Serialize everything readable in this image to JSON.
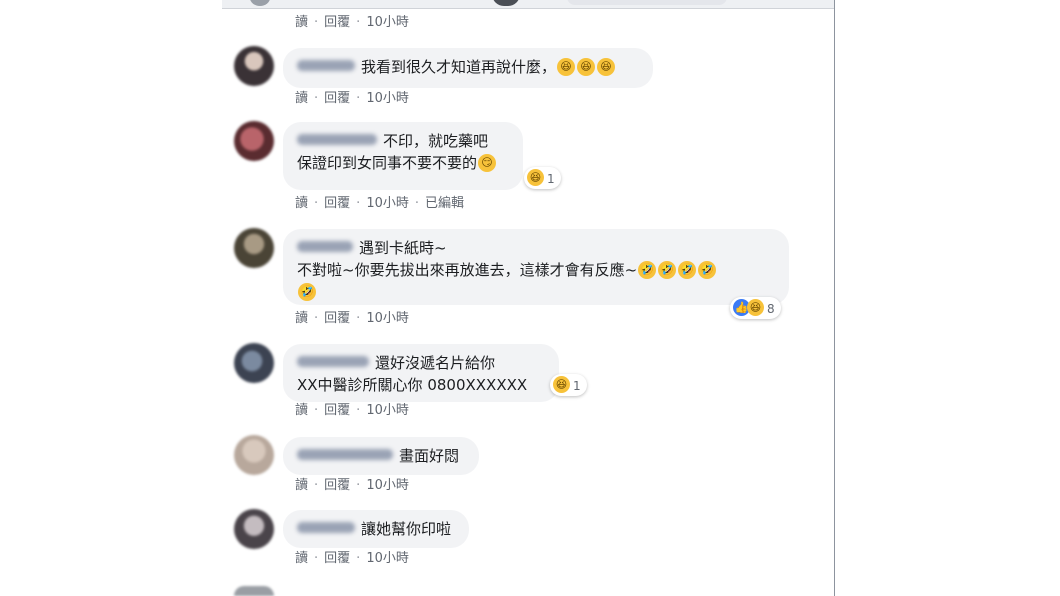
{
  "comments": [
    {
      "lines": [],
      "actions": {
        "read": "讀",
        "reply": "回覆",
        "time": "10小時",
        "edited": ""
      }
    },
    {
      "lines": [
        "我看到很久才知道再說什麼，"
      ],
      "emoji": [
        "laughing-emoji",
        "laughing-emoji",
        "laughing-emoji"
      ],
      "actions": {
        "read": "讀",
        "reply": "回覆",
        "time": "10小時",
        "edited": ""
      }
    },
    {
      "lines": [
        "不印，就吃藥吧",
        "保證印到女同事不要不要的"
      ],
      "reaction": {
        "icons": [
          "haha-icon"
        ],
        "count": "1"
      },
      "actions": {
        "read": "讀",
        "reply": "回覆",
        "time": "10小時",
        "edited": "已編輯"
      }
    },
    {
      "lines": [
        "遇到卡紙時~",
        "不對啦~你要先拔出來再放進去，這樣才會有反應~"
      ],
      "reaction": {
        "icons": [
          "like-icon",
          "haha-icon"
        ],
        "count": "8"
      },
      "actions": {
        "read": "讀",
        "reply": "回覆",
        "time": "10小時",
        "edited": ""
      }
    },
    {
      "lines": [
        "還好沒遞名片給你",
        "XX中醫診所關心你 0800XXXXXX"
      ],
      "reaction": {
        "icons": [
          "haha-icon"
        ],
        "count": "1"
      },
      "actions": {
        "read": "讀",
        "reply": "回覆",
        "time": "10小時",
        "edited": ""
      }
    },
    {
      "lines": [
        "畫面好悶"
      ],
      "actions": {
        "read": "讀",
        "reply": "回覆",
        "time": "10小時",
        "edited": ""
      }
    },
    {
      "lines": [
        "讓她幫你印啦"
      ],
      "actions": {
        "read": "讀",
        "reply": "回覆",
        "time": "10小時",
        "edited": ""
      }
    }
  ],
  "colors": {
    "bubble": "#f2f3f5",
    "meta_text": "#616770",
    "haha": "#f7c23a",
    "like": "#3b7bf5"
  }
}
